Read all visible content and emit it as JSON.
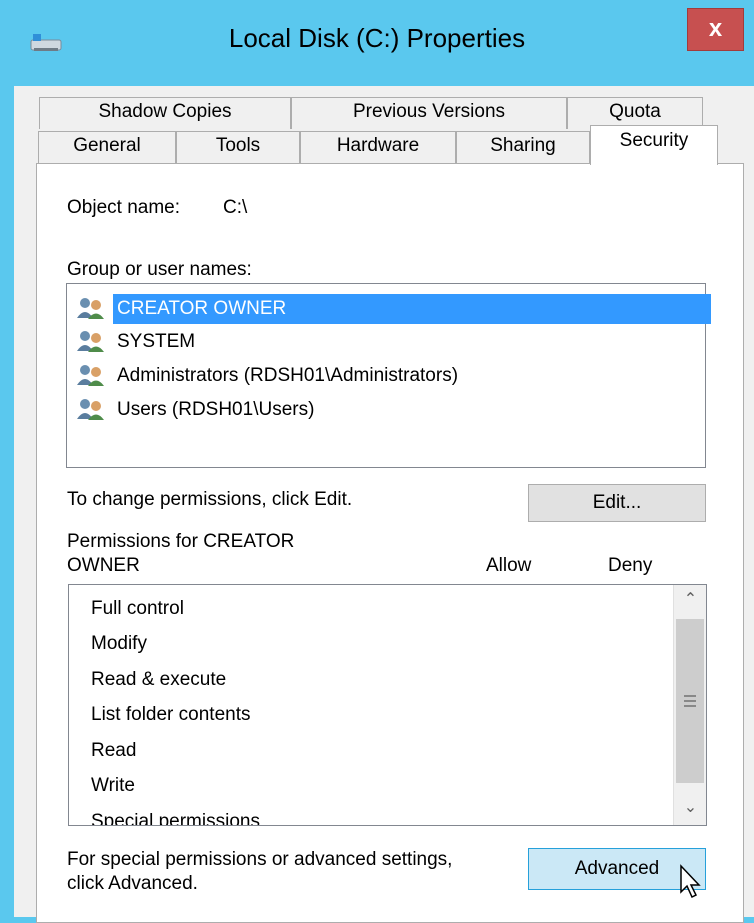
{
  "window": {
    "title": "Local Disk (C:) Properties",
    "close_label": "x"
  },
  "tabs_row1": [
    {
      "label": "Shadow Copies"
    },
    {
      "label": "Previous Versions"
    },
    {
      "label": "Quota"
    }
  ],
  "tabs_row2": [
    {
      "label": "General"
    },
    {
      "label": "Tools"
    },
    {
      "label": "Hardware"
    },
    {
      "label": "Sharing"
    },
    {
      "label": "Security",
      "selected": true
    }
  ],
  "security": {
    "object_name_label": "Object name:",
    "object_name_value": "C:\\",
    "group_label": "Group or user names:",
    "users": [
      {
        "label": "CREATOR OWNER",
        "selected": true
      },
      {
        "label": "SYSTEM"
      },
      {
        "label": "Administrators (RDSH01\\Administrators)"
      },
      {
        "label": "Users (RDSH01\\Users)"
      }
    ],
    "change_text": "To change permissions, click Edit.",
    "edit_button": "Edit...",
    "permissions_for_line1": "Permissions for CREATOR",
    "permissions_for_line2": "OWNER",
    "allow_header": "Allow",
    "deny_header": "Deny",
    "permissions": [
      {
        "label": "Full control"
      },
      {
        "label": "Modify"
      },
      {
        "label": "Read & execute"
      },
      {
        "label": "List folder contents"
      },
      {
        "label": "Read"
      },
      {
        "label": "Write"
      },
      {
        "label": "Special permissions"
      }
    ],
    "advanced_text_line1": "For special permissions or advanced settings,",
    "advanced_text_line2": "click Advanced.",
    "advanced_button": "Advanced"
  },
  "icons": {
    "app": "drive-icon",
    "user": "user-group-icon",
    "scroll_up": "chevron-up-icon",
    "scroll_down": "chevron-down-icon",
    "cursor": "mouse-cursor-icon"
  },
  "colors": {
    "titlebar": "#5ac8ee",
    "close": "#c75050",
    "selection": "#3399ff",
    "hot_button": "#cbe8f6"
  }
}
